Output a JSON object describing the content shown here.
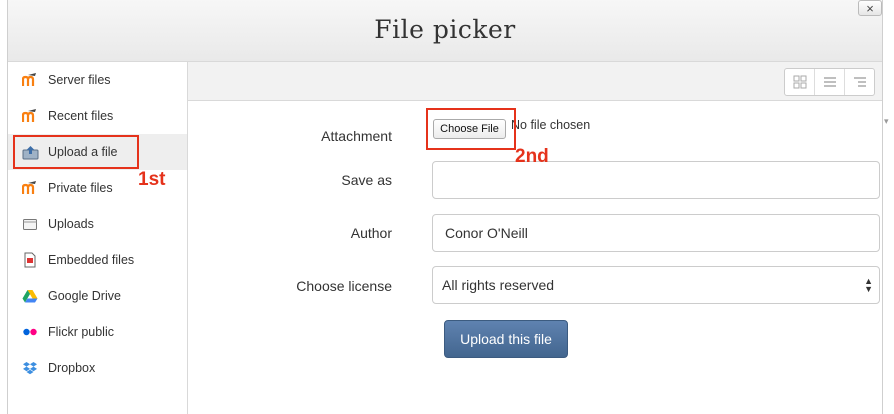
{
  "dialog": {
    "title": "File picker",
    "close_label": "×"
  },
  "sidebar": {
    "items": [
      {
        "label": "Server files",
        "icon": "moodle-icon"
      },
      {
        "label": "Recent files",
        "icon": "moodle-icon"
      },
      {
        "label": "Upload a file",
        "icon": "upload-icon",
        "active": true
      },
      {
        "label": "Private files",
        "icon": "moodle-icon"
      },
      {
        "label": "Uploads",
        "icon": "folder-icon"
      },
      {
        "label": "Embedded files",
        "icon": "document-icon"
      },
      {
        "label": "Google Drive",
        "icon": "google-drive-icon"
      },
      {
        "label": "Flickr public",
        "icon": "flickr-icon"
      },
      {
        "label": "Dropbox",
        "icon": "dropbox-icon"
      }
    ]
  },
  "toolbar": {
    "view_icons": [
      "grid-view-icon",
      "list-view-icon",
      "tree-view-icon"
    ]
  },
  "form": {
    "attachment_label": "Attachment",
    "choose_file_label": "Choose File",
    "no_file_text": "No file chosen",
    "save_as_label": "Save as",
    "save_as_value": "",
    "author_label": "Author",
    "author_value": "Conor O'Neill",
    "license_label": "Choose license",
    "license_value": "All rights reserved",
    "upload_button_label": "Upload this file"
  },
  "annotations": {
    "first": "1st",
    "second": "2nd",
    "color": "#e5321b"
  },
  "colors": {
    "upload_button": "#4f74a0",
    "moodle_orange": "#f98012"
  }
}
